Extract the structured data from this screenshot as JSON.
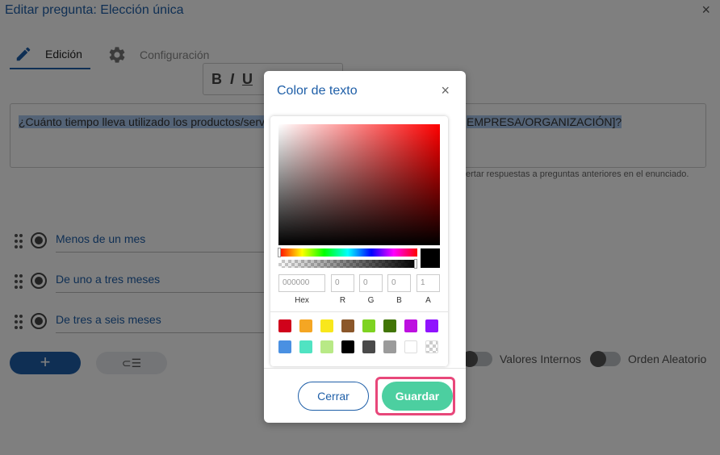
{
  "editor": {
    "title": "Editar pregunta: Elección única",
    "close_glyph": "×",
    "tabs": [
      {
        "label": "Edición",
        "icon": "pencil-icon",
        "active": true
      },
      {
        "label": "Configuración",
        "icon": "gear-icon",
        "active": false
      }
    ],
    "toolbar": {
      "bold": "B",
      "italic": "I",
      "underline": "U"
    },
    "question_visible_left": "¿Cuánto tiempo lleva utilizado los productos/serv",
    "question_visible_right": "EMPRESA/ORGANIZACIÓN]?",
    "hint_visible": "ertar respuestas a preguntas anteriores en el enunciado.",
    "answers": [
      {
        "label": "Menos de un mes"
      },
      {
        "label": "De uno a tres meses"
      },
      {
        "label": "De tres a seis meses"
      }
    ],
    "add_button": "+",
    "list_button": "⊂☰",
    "toggles": [
      {
        "label": "Valores Internos",
        "on": false
      },
      {
        "label": "Orden Aleatorio",
        "on": false
      }
    ]
  },
  "modal": {
    "title": "Color de texto",
    "close_glyph": "×",
    "picker": {
      "hex_placeholder": "000000",
      "r": "0",
      "g": "0",
      "b": "0",
      "a": "1",
      "labels": {
        "hex": "Hex",
        "r": "R",
        "g": "G",
        "b": "B",
        "a": "A"
      },
      "current_color": "#000000",
      "base_hue": "#ff0000",
      "swatches": [
        "#d0021b",
        "#f5a623",
        "#f8e71c",
        "#8b572a",
        "#7ed321",
        "#417505",
        "#bd10e0",
        "#9013fe",
        "#4a90e2",
        "#50e3c2",
        "#b8e986",
        "#000000",
        "#4a4a4a",
        "#9b9b9b",
        "#ffffff",
        "transparent"
      ]
    },
    "cancel_label": "Cerrar",
    "save_label": "Guardar"
  },
  "colors": {
    "accent": "#1f5fa8",
    "save": "#4ccfa0",
    "highlight": "#e8477a"
  }
}
